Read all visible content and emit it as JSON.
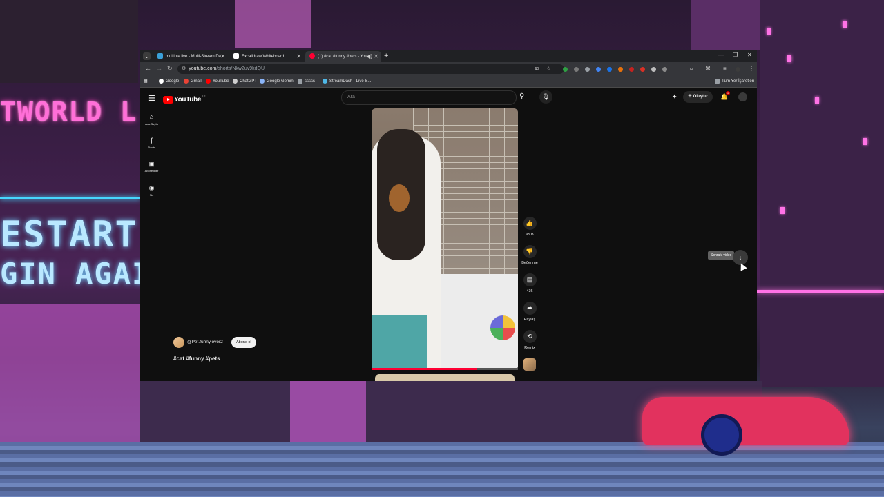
{
  "tabs": [
    {
      "title": "multiple.live - Multi-Stream Da",
      "icon": "multiple-live-favicon"
    },
    {
      "title": "Excalidraw Whiteboard",
      "icon": "excalidraw-favicon"
    },
    {
      "title": "(1) #cat #funny #pets - You",
      "icon": "youtube-favicon",
      "active": true
    }
  ],
  "address_bar": {
    "domain": "youtube.com",
    "path": "/shorts/Nkw2uv9kdQU"
  },
  "bookmarks": [
    {
      "label": "Google",
      "color": "#ffffff"
    },
    {
      "label": "Gmail",
      "color": "#ea4335"
    },
    {
      "label": "YouTube",
      "color": "#ff0000"
    },
    {
      "label": "ChatGPT",
      "color": "#cfcfcf"
    },
    {
      "label": "Google Gemini",
      "color": "#8ab4f8"
    },
    {
      "label": "sssss",
      "color": "#9aa0a6"
    },
    {
      "label": "StreamDash - Live S...",
      "color": "#4fb8e6"
    }
  ],
  "all_bookmarks": "Tüm Yer İşaretleri",
  "youtube": {
    "logo_text": "YouTube",
    "country_code": "TR",
    "search_placeholder": "Ara",
    "create_label": "Oluştur",
    "notification_count": "1",
    "sidebar": [
      {
        "label": "Ana Sayfa",
        "icon": "home-icon"
      },
      {
        "label": "Shorts",
        "icon": "shorts-icon"
      },
      {
        "label": "Abonelikler",
        "icon": "subscriptions-icon"
      },
      {
        "label": "Siz",
        "icon": "you-icon"
      }
    ],
    "actions": {
      "like_count": "95 B",
      "dislike_label": "Beğenme",
      "comment_count": "436",
      "share_label": "Paylaş",
      "remix_label": "Remix"
    },
    "channel": {
      "name": "@Pet.funnylover2",
      "subscribe_label": "Abone ol"
    },
    "hashtags": "#cat #funny #pets",
    "next_video_tooltip": "Sonraki video",
    "progress_fraction": 0.72
  }
}
